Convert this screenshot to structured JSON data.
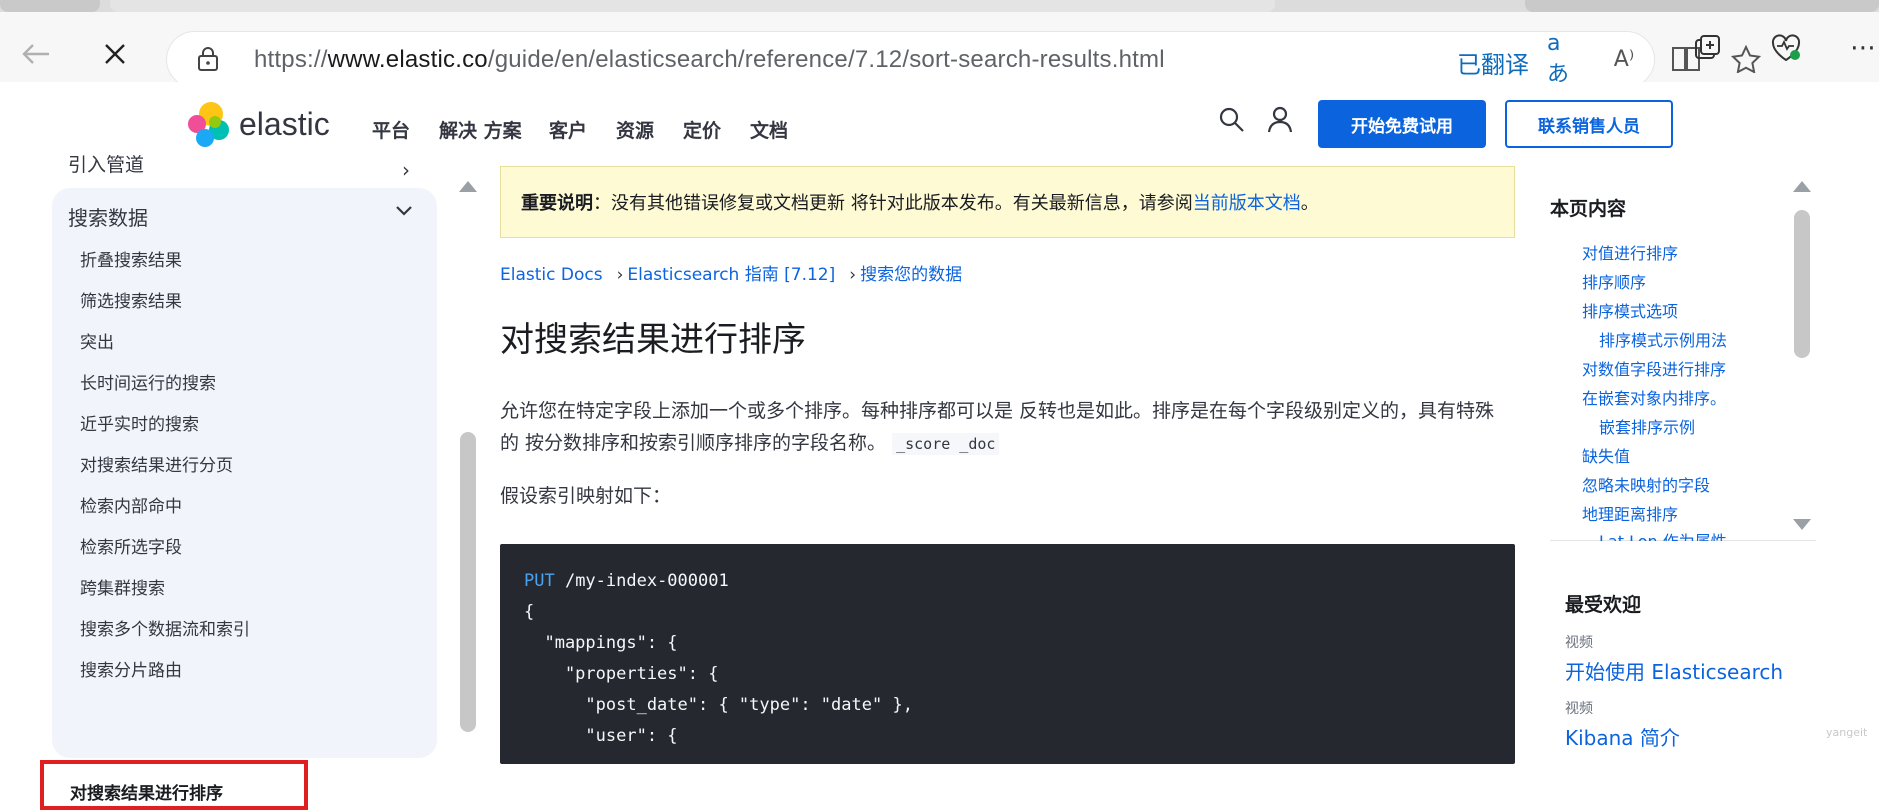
{
  "browser": {
    "url_prefix": "https://",
    "url_host": "www.elastic.co",
    "url_path": "/guide/en/elasticsearch/reference/7.12/sort-search-results.html",
    "translated_label": "已翻译",
    "icons": [
      "back-icon",
      "close-icon",
      "lock-icon",
      "translate-icon",
      "read-aloud-icon",
      "immersive-reader-icon",
      "favorite-star-icon",
      "collections-icon",
      "health-icon",
      "more-icon"
    ]
  },
  "header": {
    "logo_text": "elastic",
    "nav": [
      "平台",
      "解决 方案",
      "客户",
      "资源",
      "定价",
      "文档"
    ],
    "trial_button": "开始免费试用",
    "sales_button": "联系销售人员"
  },
  "sidebar": {
    "prev_item": "引入管道",
    "group_title": "搜索数据",
    "items": [
      "折叠搜索结果",
      "筛选搜索结果",
      "突出",
      "长时间运行的搜索",
      "近乎实时的搜索",
      "对搜索结果进行分页",
      "检索内部命中",
      "检索所选字段",
      "跨集群搜索",
      "搜索多个数据流和索引",
      "搜索分片路由"
    ],
    "active_item": "对搜索结果进行排序"
  },
  "notice": {
    "label": "重要说明",
    "text": "：没有其他错误修复或文档更新 将针对此版本发布。有关最新信息，请参阅",
    "link": "当前版本文档",
    "end": "。"
  },
  "breadcrumbs": [
    "Elastic Docs",
    "Elasticsearch 指南 [7.12]",
    "搜索您的数据"
  ],
  "article": {
    "title": "对搜索结果进行排序",
    "intro_line1": "允许您在特定字段上添加一个或多个排序。每种排序都可以是 反转也是如此。排序是在每个字段级别定义的，具有特殊",
    "intro_line2": "的 按分数排序和按索引顺序排序的字段名称。",
    "intro_code": "_score _doc",
    "mapping_intro": "假设索引映射如下：",
    "code": {
      "method": "PUT",
      "path": " /my-index-000001",
      "lines": [
        "{",
        "  \"mappings\": {",
        "    \"properties\": {",
        "      \"post_date\": { \"type\": \"date\" },",
        "      \"user\": {"
      ]
    }
  },
  "toc": {
    "title": "本页内容",
    "items": [
      "对值进行排序",
      "排序顺序",
      "排序模式选项",
      "排序模式示例用法",
      "对数值字段进行排序",
      "在嵌套对象内排序。",
      "嵌套排序示例",
      "缺失值",
      "忽略未映射的字段",
      "地理距离排序",
      "Lat Lon 作为属性"
    ]
  },
  "popular": {
    "title": "最受欢迎",
    "items": [
      {
        "kind": "视频",
        "label": "开始使用 Elasticsearch"
      },
      {
        "kind": "视频",
        "label": "Kibana 简介"
      }
    ]
  },
  "watermark": "yangeit",
  "colors": {
    "accent": "#0b64dd",
    "notice_bg": "#fefad4",
    "active_outline": "#e02020",
    "code_bg": "#25282f"
  }
}
